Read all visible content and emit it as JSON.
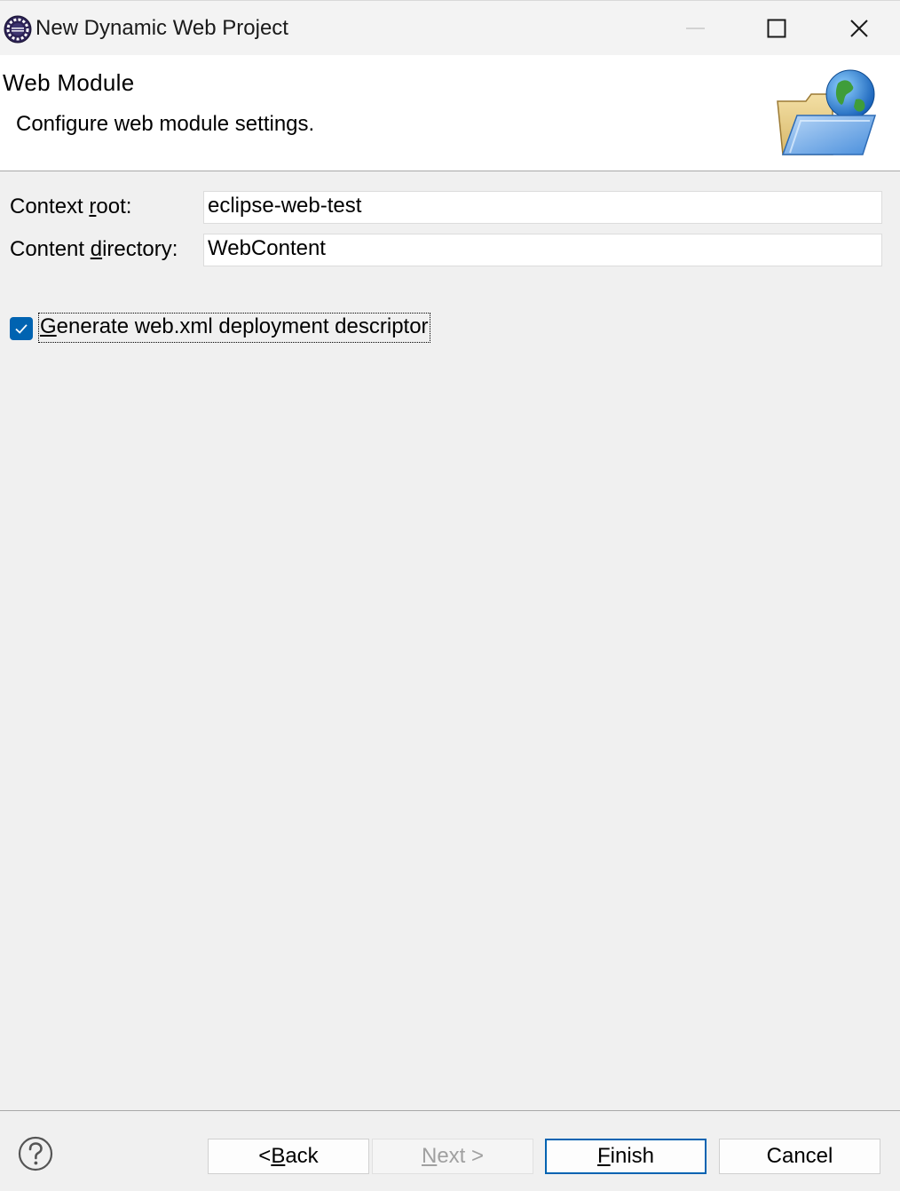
{
  "window": {
    "title": "New Dynamic Web Project",
    "icon": "eclipse-icon",
    "controls": [
      "minimize-icon",
      "maximize-icon",
      "close-icon"
    ]
  },
  "banner": {
    "title": "Web Module",
    "description": "Configure web module settings.",
    "icon": "folder-globe-icon"
  },
  "form": {
    "context_root": {
      "label_pre": "Context ",
      "label_mnemonic": "r",
      "label_post": "oot:",
      "value": "eclipse-web-test"
    },
    "content_directory": {
      "label_pre": "Content ",
      "label_mnemonic": "d",
      "label_post": "irectory:",
      "value": "WebContent"
    },
    "generate_webxml": {
      "checked": true,
      "label_mnemonic": "G",
      "label_post": "enerate web.xml deployment descriptor"
    }
  },
  "buttons": {
    "back": {
      "pre": "< ",
      "mnemonic": "B",
      "post": "ack"
    },
    "next": {
      "mnemonic": "N",
      "post": "ext >",
      "enabled": false
    },
    "finish": {
      "mnemonic": "F",
      "post": "inish",
      "default": true
    },
    "cancel": {
      "label": "Cancel"
    }
  },
  "colors": {
    "accent": "#0063b1",
    "background": "#f0f0f0",
    "banner_background": "#ffffff"
  }
}
